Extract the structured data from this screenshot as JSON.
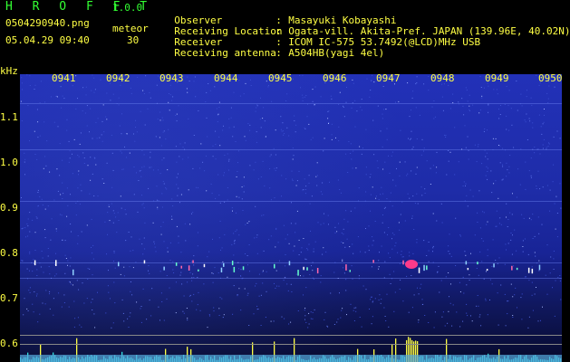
{
  "header": {
    "app_name": "H R O F F T",
    "version": "1.0.0",
    "filename": "0504290940.png",
    "meteor_label": "meteor",
    "datetime": "05.04.29 09:40",
    "meteor_count": "30"
  },
  "info": [
    {
      "key": "Observer",
      "value": "Masayuki Kobayashi"
    },
    {
      "key": "Receiving Location",
      "value": "Ogata-vill. Akita-Pref. JAPAN (139.96E, 40.02N)"
    },
    {
      "key": "Receiver",
      "value": "ICOM IC-575 53.7492(@LCD)MHz USB"
    },
    {
      "key": "Receiving antenna",
      "value": "A504HB(yagi 4el)"
    }
  ],
  "plot": {
    "unit": "kHz",
    "time_ticks": [
      "0941",
      "0942",
      "0943",
      "0944",
      "0945",
      "0946",
      "0947",
      "0948",
      "0949",
      "0950"
    ],
    "freq_ticks": [
      "1.1",
      "1.0",
      "0.9",
      "0.8",
      "0.7",
      "0.6"
    ]
  },
  "colors": {
    "green": "#33ff33",
    "yellow": "#ffff44",
    "spectrum_blue": "#1e2ca8"
  }
}
